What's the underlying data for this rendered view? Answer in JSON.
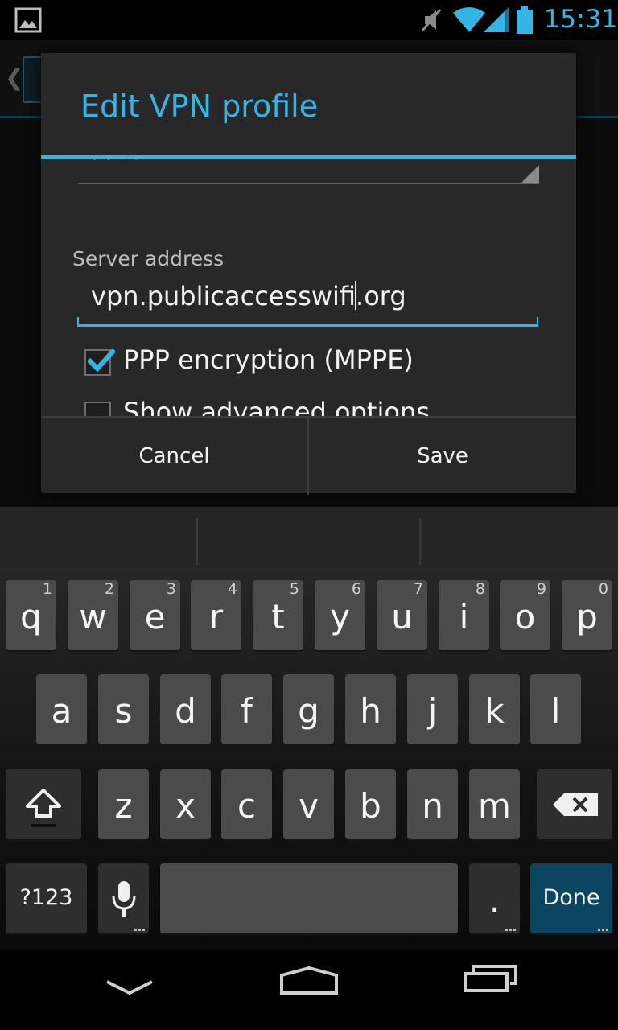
{
  "status_bar": {
    "time": "15:31",
    "icons": [
      "picture-notification-icon",
      "mute-icon",
      "wifi-icon",
      "signal-icon",
      "battery-icon"
    ]
  },
  "dialog": {
    "title": "Edit VPN profile",
    "type_value": "PPTP",
    "server_label": "Server address",
    "server_value_before_cursor": "vpn.publicaccesswifi",
    "server_value_after_cursor": ".org",
    "ppp_encryption": {
      "label": "PPP encryption (MPPE)",
      "checked": true
    },
    "advanced": {
      "label": "Show advanced options",
      "checked": false
    },
    "cancel_label": "Cancel",
    "save_label": "Save"
  },
  "keyboard": {
    "row1": [
      {
        "key": "q",
        "hint": "1"
      },
      {
        "key": "w",
        "hint": "2"
      },
      {
        "key": "e",
        "hint": "3"
      },
      {
        "key": "r",
        "hint": "4"
      },
      {
        "key": "t",
        "hint": "5"
      },
      {
        "key": "y",
        "hint": "6"
      },
      {
        "key": "u",
        "hint": "7"
      },
      {
        "key": "i",
        "hint": "8"
      },
      {
        "key": "o",
        "hint": "9"
      },
      {
        "key": "p",
        "hint": "0"
      }
    ],
    "row2": [
      "a",
      "s",
      "d",
      "f",
      "g",
      "h",
      "j",
      "k",
      "l"
    ],
    "row3": [
      "z",
      "x",
      "c",
      "v",
      "b",
      "n",
      "m"
    ],
    "symbols_label": "?123",
    "period_label": ".",
    "done_label": "Done"
  },
  "colors": {
    "accent": "#33b5e5",
    "dialog_bg": "#282828",
    "key_bg": "#4b4b4b",
    "done_key_bg": "#0b4561"
  }
}
